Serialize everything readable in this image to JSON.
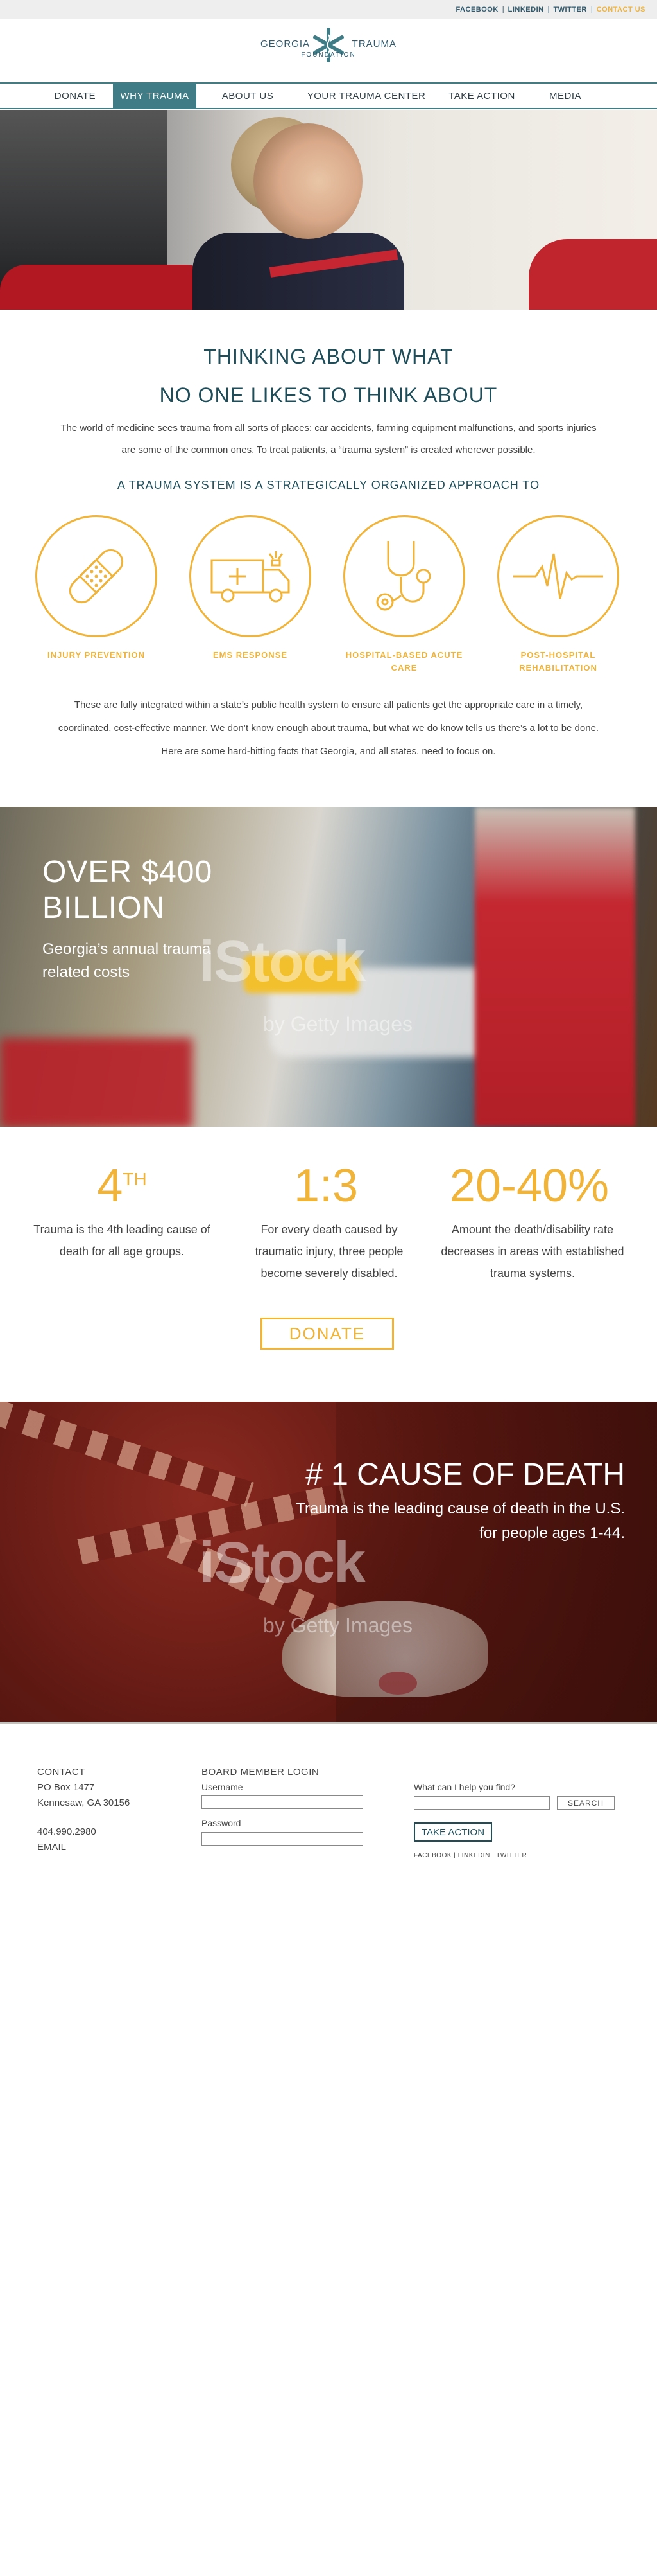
{
  "topbar": {
    "links": [
      "FACEBOOK",
      "LINKEDIN",
      "TWITTER",
      "CONTACT US"
    ]
  },
  "logo": {
    "left": "GEORGIA",
    "right": "TRAUMA",
    "sub": "FOUNDATION"
  },
  "nav": {
    "items": [
      "DONATE",
      "WHY TRAUMA",
      "ABOUT US",
      "YOUR TRAUMA CENTER",
      "TAKE ACTION",
      "MEDIA"
    ],
    "active": "WHY TRAUMA"
  },
  "intro": {
    "title_line1": "THINKING ABOUT WHAT",
    "title_line2": "NO ONE LIKES TO THINK ABOUT",
    "paragraph": "The world of medicine sees trauma from all sorts of places: car accidents, farming equipment malfunctions, and sports injuries are some of the common ones. To treat patients, a “trauma system” is created wherever possible.",
    "subhead": "A TRAUMA SYSTEM IS A STRATEGICALLY ORGANIZED APPROACH TO"
  },
  "approach": [
    {
      "icon": "bandage-icon",
      "label": "INJURY PREVENTION"
    },
    {
      "icon": "ambulance-icon",
      "label": "EMS RESPONSE"
    },
    {
      "icon": "stethoscope-icon",
      "label": "HOSPITAL-BASED ACUTE CARE"
    },
    {
      "icon": "heartbeat-icon",
      "label": "POST-HOSPITAL REHABILITATION"
    }
  ],
  "system_text": "These are fully integrated within a state’s public health system to ensure all patients get the appropriate care in a timely, coordinated, cost-effective manner. We don’t know enough about trauma, but what we do know tells us there’s a lot to be done. Here are some hard-hitting facts that Georgia, and all states, need to focus on.",
  "cost": {
    "headline_line1": "OVER $400",
    "headline_line2": "BILLION",
    "sub": "Georgia’s annual trauma related costs"
  },
  "watermark": {
    "text": "iStock",
    "sub": "by Getty Images"
  },
  "stats": [
    {
      "number": "4",
      "sup": "TH",
      "desc": "Trauma is the 4th leading cause of death for all age groups."
    },
    {
      "number": "1:3",
      "sup": "",
      "desc": "For every death caused by traumatic injury, three people become severely disabled."
    },
    {
      "number": "20-40%",
      "sup": "",
      "desc": "Amount the death/disability rate decreases in areas with established trauma systems."
    }
  ],
  "donate_label": "DONATE",
  "cause": {
    "title": "# 1 CAUSE OF DEATH",
    "sub": "Trauma is the leading cause of death in the U.S. for people ages 1-44."
  },
  "footer": {
    "contact_label": "CONTACT",
    "address_line1": "PO Box 1477",
    "address_line2": "Kennesaw, GA 30156",
    "phone": "404.990.2980",
    "email": "EMAIL",
    "login_label": "BOARD MEMBER LOGIN",
    "username_label": "Username",
    "password_label": "Password",
    "search_label": "What can I help you find?",
    "search_button": "SEARCH",
    "take_action": "TAKE ACTION",
    "social": [
      "FACEBOOK",
      "LINKEDIN",
      "TWITTER"
    ]
  },
  "colors": {
    "accent": "#f0b43a",
    "teal": "#3f7c86",
    "dark_teal": "#1f4e5a"
  }
}
